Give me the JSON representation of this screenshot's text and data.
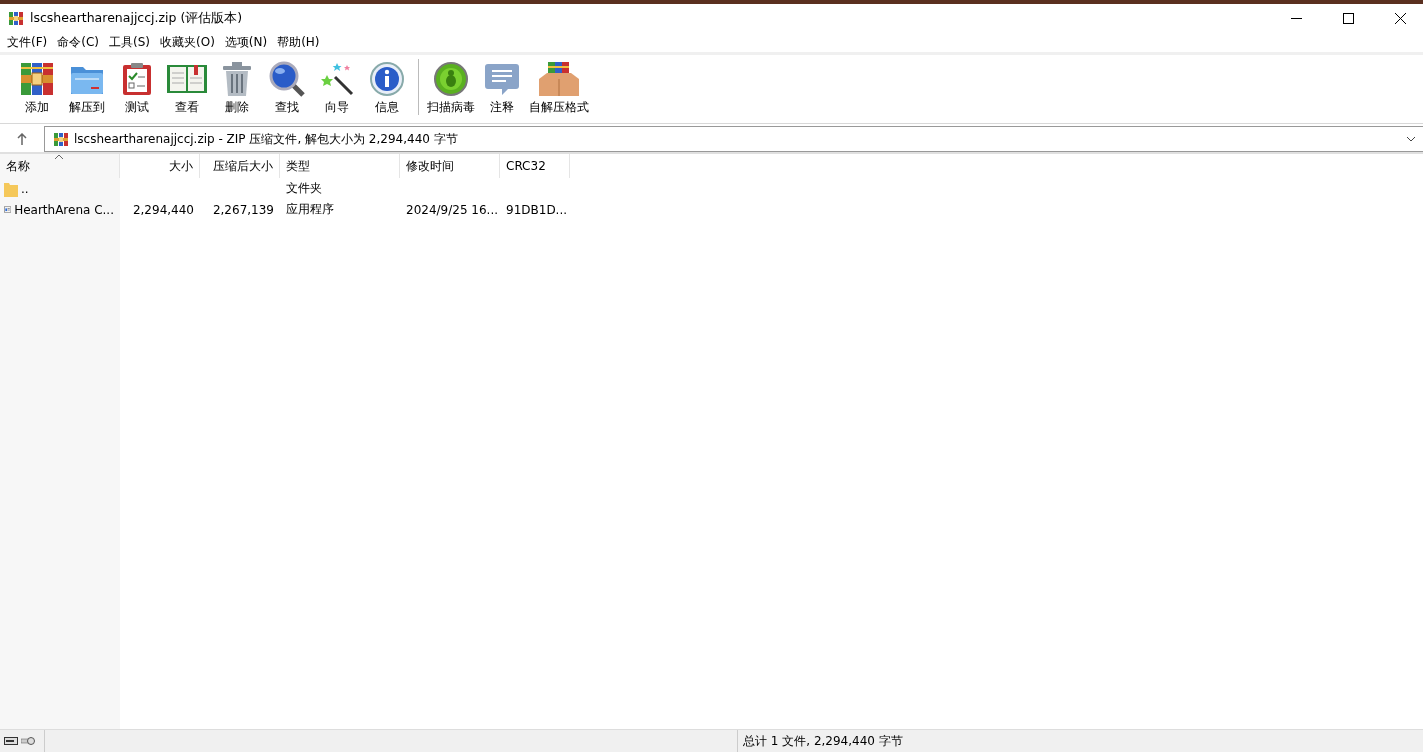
{
  "window": {
    "title": "lscsheartharenajjccj.zip (评估版本)"
  },
  "menu": [
    "文件(F)",
    "命令(C)",
    "工具(S)",
    "收藏夹(O)",
    "选项(N)",
    "帮助(H)"
  ],
  "toolbar": [
    {
      "label": "添加",
      "kind": "books"
    },
    {
      "label": "解压到",
      "kind": "folder"
    },
    {
      "label": "测试",
      "kind": "clipboard"
    },
    {
      "label": "查看",
      "kind": "book"
    },
    {
      "label": "删除",
      "kind": "trash"
    },
    {
      "label": "查找",
      "kind": "magnifier"
    },
    {
      "label": "向导",
      "kind": "wand"
    },
    {
      "label": "信息",
      "kind": "info"
    },
    {
      "label": "扫描病毒",
      "kind": "bug",
      "separator_before": true
    },
    {
      "label": "注释",
      "kind": "comment"
    },
    {
      "label": "自解压格式",
      "kind": "box"
    }
  ],
  "address_bar": {
    "path": "lscsheartharenajjccj.zip - ZIP 压缩文件, 解包大小为 2,294,440 字节"
  },
  "table": {
    "columns": [
      "名称",
      "大小",
      "压缩后大小",
      "类型",
      "修改时间",
      "CRC32"
    ],
    "rows": [
      {
        "kind": "folder",
        "cells": [
          "..",
          "",
          "",
          "文件夹",
          "",
          ""
        ]
      },
      {
        "kind": "app",
        "cells": [
          "HearthArena C...",
          "2,294,440",
          "2,267,139",
          "应用程序",
          "2024/9/25 16...",
          "91DB1D..."
        ]
      }
    ]
  },
  "status_bar": {
    "text": "总计 1 文件, 2,294,440 字节"
  }
}
